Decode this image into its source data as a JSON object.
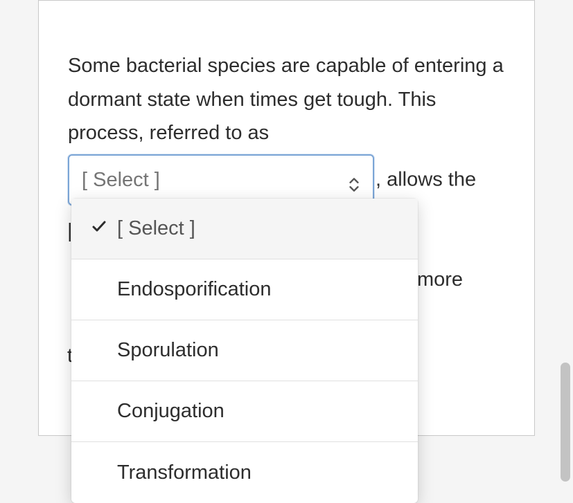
{
  "question": {
    "text_before": "Some bacterial species are capable of entering a dormant state when times get tough. This process, referred to as",
    "text_after": ", allows the",
    "hidden_fragment_1": "|",
    "hidden_fragment_2": "il more",
    "hidden_fragment_3": "t"
  },
  "select": {
    "placeholder": "[ Select ]"
  },
  "dropdown": {
    "options": [
      {
        "label": "[ Select ]",
        "selected": true
      },
      {
        "label": "Endosporification",
        "selected": false
      },
      {
        "label": "Sporulation",
        "selected": false
      },
      {
        "label": "Conjugation",
        "selected": false
      },
      {
        "label": "Transformation",
        "selected": false
      }
    ]
  }
}
